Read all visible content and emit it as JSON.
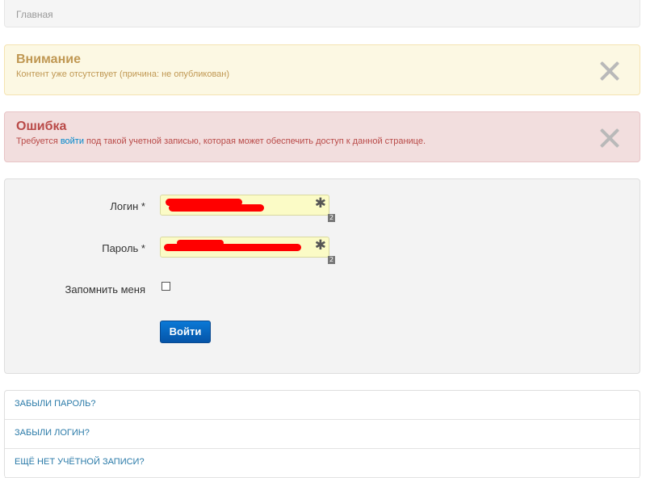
{
  "breadcrumb": {
    "home": "Главная"
  },
  "warning": {
    "title": "Внимание",
    "message": "Контент уже отсутствует (причина: не опубликован)"
  },
  "error": {
    "title": "Ошибка",
    "message_prefix": "Требуется ",
    "message_link": "войти",
    "message_suffix": " под такой учетной записью, которая может обеспечить доступ к данной странице."
  },
  "form": {
    "username_label": "Логин *",
    "password_label": "Пароль *",
    "remember_label": "Запомнить меня",
    "remember_checked": false,
    "required_marker": "✱",
    "field_badge": "2",
    "submit_label": "Войти"
  },
  "links": [
    "ЗАБЫЛИ ПАРОЛЬ?",
    "ЗАБЫЛИ ЛОГИН?",
    "ЕЩЁ НЕТ УЧЁТНОЙ ЗАПИСИ?"
  ],
  "colors": {
    "warning_bg": "#fcf8e3",
    "warning_text": "#c09853",
    "error_bg": "#f2dede",
    "error_text": "#b94a48",
    "field_bg": "#fbfbc6",
    "button_bg": "#0a6ac4",
    "link": "#2a7aa8"
  }
}
